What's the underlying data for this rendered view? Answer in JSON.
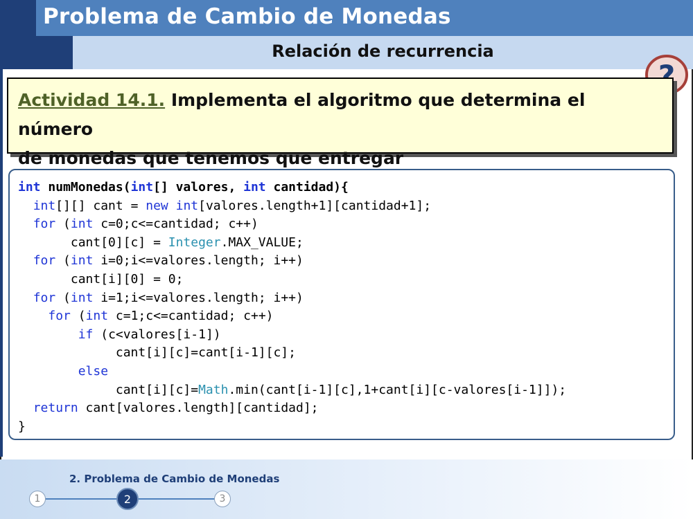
{
  "header": {
    "title": "Problema de Cambio de Monedas",
    "subtitle": "Relación de recurrencia"
  },
  "activity": {
    "label": "Actividad 14.1.",
    "text_line1": " Implementa el algoritmo que determina el número",
    "text_line2": "de monedas que tenemos que entregar"
  },
  "help_icon": "question-mark-icon",
  "code": {
    "lines": [
      [
        {
          "t": "int",
          "c": "kw-b"
        },
        {
          "t": " numMonedas(",
          "c": "b"
        },
        {
          "t": "int",
          "c": "kw-b"
        },
        {
          "t": "[] valores, ",
          "c": "b"
        },
        {
          "t": "int",
          "c": "kw-b"
        },
        {
          "t": " cantidad){",
          "c": "b"
        }
      ],
      [
        {
          "t": "  "
        },
        {
          "t": "int",
          "c": "kw"
        },
        {
          "t": "[][] cant = "
        },
        {
          "t": "new",
          "c": "kw"
        },
        {
          "t": " "
        },
        {
          "t": "int",
          "c": "kw"
        },
        {
          "t": "[valores.length+1][cantidad+1];"
        }
      ],
      [
        {
          "t": "  "
        },
        {
          "t": "for",
          "c": "kw"
        },
        {
          "t": " ("
        },
        {
          "t": "int",
          "c": "kw"
        },
        {
          "t": " c=0;c<=cantidad; c++)"
        }
      ],
      [
        {
          "t": "       cant[0][c] = "
        },
        {
          "t": "Integer",
          "c": "ty"
        },
        {
          "t": ".MAX_VALUE;"
        }
      ],
      [
        {
          "t": "  "
        },
        {
          "t": "for",
          "c": "kw"
        },
        {
          "t": " ("
        },
        {
          "t": "int",
          "c": "kw"
        },
        {
          "t": " i=0;i<=valores.length; i++)"
        }
      ],
      [
        {
          "t": "       cant[i][0] = 0;"
        }
      ],
      [
        {
          "t": "  "
        },
        {
          "t": "for",
          "c": "kw"
        },
        {
          "t": " ("
        },
        {
          "t": "int",
          "c": "kw"
        },
        {
          "t": " i=1;i<=valores.length; i++)"
        }
      ],
      [
        {
          "t": "    "
        },
        {
          "t": "for",
          "c": "kw"
        },
        {
          "t": " ("
        },
        {
          "t": "int",
          "c": "kw"
        },
        {
          "t": " c=1;c<=cantidad; c++)"
        }
      ],
      [
        {
          "t": "        "
        },
        {
          "t": "if",
          "c": "kw"
        },
        {
          "t": " (c<valores[i-1])"
        }
      ],
      [
        {
          "t": "             cant[i][c]=cant[i-1][c];"
        }
      ],
      [
        {
          "t": "        "
        },
        {
          "t": "else",
          "c": "kw"
        }
      ],
      [
        {
          "t": "             cant[i][c]="
        },
        {
          "t": "Math",
          "c": "ty"
        },
        {
          "t": ".min(cant[i-1][c],1+cant[i][c-valores[i-1]]);"
        }
      ],
      [
        {
          "t": "  "
        },
        {
          "t": "return",
          "c": "kw"
        },
        {
          "t": " cant[valores.length][cantidad];"
        }
      ],
      [
        {
          "t": "}"
        }
      ]
    ]
  },
  "footer": {
    "section_label": "2. Problema de Cambio de Monedas",
    "steps": [
      "1",
      "2",
      "3"
    ],
    "current_step": "2"
  },
  "colors": {
    "header_bar": "#4f81bd",
    "header_dark": "#1f3f78",
    "subheader_bar": "#c6d9f0",
    "activity_bg": "#ffffd9",
    "activity_label": "#4f6228",
    "keyword": "#1f35d6",
    "type": "#2b91af"
  }
}
